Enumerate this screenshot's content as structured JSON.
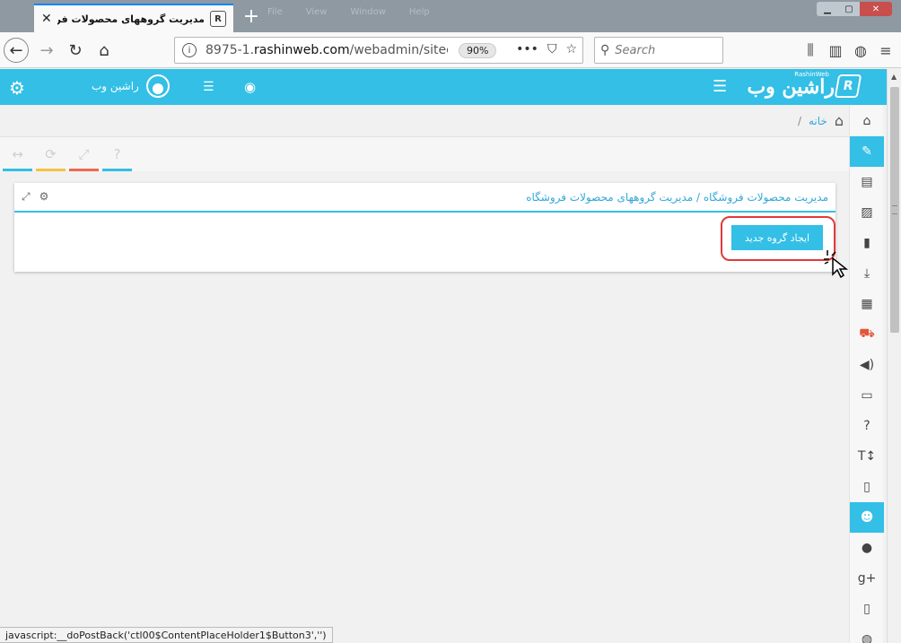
{
  "browser": {
    "tab_title": "مدیریت گروههای محصولات فروشگاه",
    "ghost_menu": [
      "File",
      "View",
      "Window",
      "Help"
    ],
    "url_prefix": "8975-1.",
    "url_domain": "rashinweb.com",
    "url_path": "/webadmin/siteco",
    "zoom": "90%",
    "search_placeholder": "Search",
    "status_text": "javascript:__doPostBack('ctl00$ContentPlaceHolder1$Button3','')"
  },
  "header": {
    "logo_text": "راشین وب",
    "logo_sub": "RashinWeb",
    "user_name": "راشین وب"
  },
  "breadcrumb": {
    "home": "خانه",
    "separator": "/"
  },
  "toolbar": {
    "colors": [
      "#33bfe6",
      "#f6c342",
      "#f0684e",
      "#33bfe6"
    ]
  },
  "panel": {
    "title": "مدیریت محصولات فروشگاه / مدیریت گروههای محصولات فروشگاه",
    "new_group_button": "ایجاد گروه جدید"
  },
  "sidebar": {
    "items": [
      {
        "icon": "home-icon"
      },
      {
        "icon": "pencil-icon",
        "active": true
      },
      {
        "icon": "newspaper-icon"
      },
      {
        "icon": "image-icon"
      },
      {
        "icon": "document-icon"
      },
      {
        "icon": "download-icon"
      },
      {
        "icon": "film-icon"
      },
      {
        "icon": "cart-icon"
      },
      {
        "icon": "speaker-icon"
      },
      {
        "icon": "monitor-icon"
      },
      {
        "icon": "question-icon"
      },
      {
        "icon": "text-size-icon"
      },
      {
        "icon": "file-icon"
      },
      {
        "icon": "users-icon",
        "active": true
      },
      {
        "icon": "user-icon"
      },
      {
        "icon": "google-plus-icon"
      },
      {
        "icon": "mobile-icon"
      },
      {
        "icon": "comments-icon"
      }
    ]
  }
}
